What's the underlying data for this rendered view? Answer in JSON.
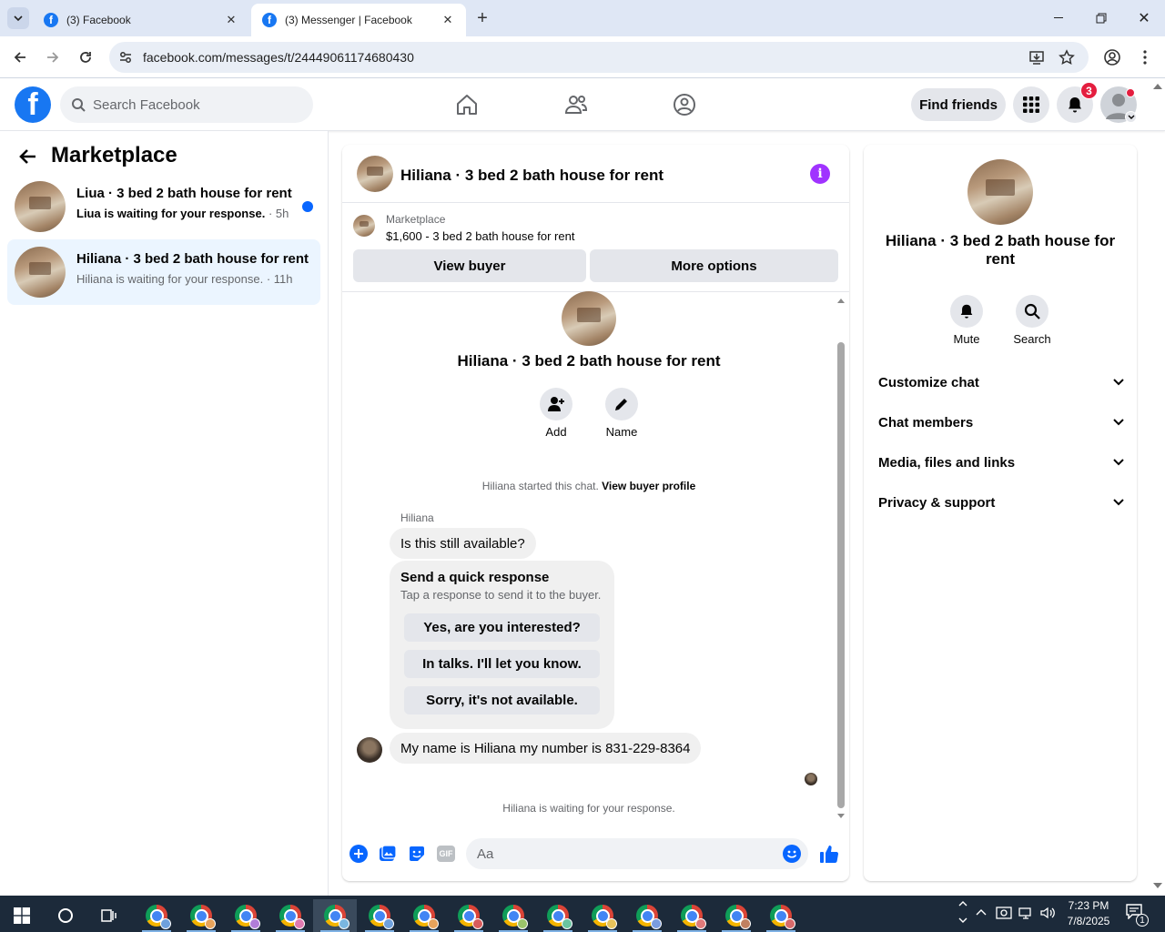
{
  "browser": {
    "tabs": [
      {
        "title": "(3) Facebook",
        "active": false
      },
      {
        "title": "(3) Messenger | Facebook",
        "active": true
      }
    ],
    "url": "facebook.com/messages/t/24449061174680430"
  },
  "fb_header": {
    "search_placeholder": "Search Facebook",
    "find_friends_label": "Find friends",
    "notification_count": "3"
  },
  "left_panel": {
    "title": "Marketplace",
    "conversations": [
      {
        "title": "Liua · 3 bed 2 bath house for rent",
        "subtitle": "Liua is waiting for your response.",
        "time": " · 5h",
        "unread": true
      },
      {
        "title": "Hiliana · 3 bed 2 bath house for rent",
        "subtitle": "Hiliana is waiting for your response.",
        "time": " · 11h",
        "unread": false,
        "selected": true
      }
    ]
  },
  "chat": {
    "header_title": "Hiliana · 3 bed 2 bath house for rent",
    "listing": {
      "label": "Marketplace",
      "detail": "$1,600 - 3 bed 2 bath house for rent",
      "view_buyer": "View buyer",
      "more_options": "More options"
    },
    "intro": {
      "title": "Hiliana · 3 bed 2 bath house for rent",
      "add_label": "Add",
      "name_label": "Name"
    },
    "started_text": "Hiliana started this chat. ",
    "view_profile_link": "View buyer profile",
    "sender_name": "Hiliana",
    "messages": {
      "first": "Is this still available?",
      "last": "My name is Hiliana my number is 831-229-8364"
    },
    "quick_response": {
      "title": "Send a quick response",
      "subtitle": "Tap a response to send it to the buyer.",
      "options": [
        "Yes, are you interested?",
        "In talks. I'll let you know.",
        "Sorry, it's not available."
      ]
    },
    "waiting_text": "Hiliana is waiting for your response.",
    "composer_placeholder": "Aa"
  },
  "info_panel": {
    "title": "Hiliana · 3 bed 2 bath house for rent",
    "mute_label": "Mute",
    "search_label": "Search",
    "sections": [
      "Customize chat",
      "Chat members",
      "Media, files and links",
      "Privacy & support"
    ]
  },
  "taskbar": {
    "time": "7:23 PM",
    "date": "7/8/2025",
    "notification_count": "1"
  },
  "colors": {
    "facebook_blue": "#1877f2",
    "messenger_purple": "#a033ff",
    "badge_red": "#e41e3f",
    "selected_bg": "#ebf5ff"
  }
}
